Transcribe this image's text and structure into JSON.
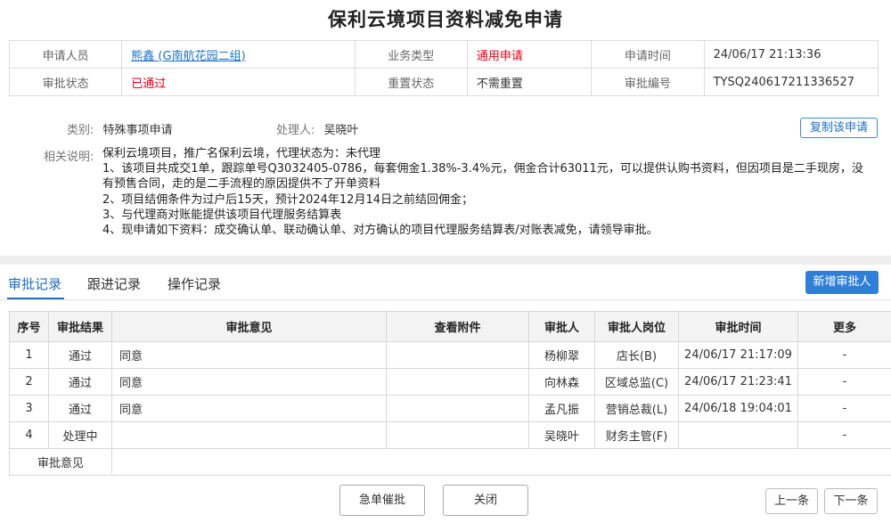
{
  "title": "保利云境项目资料减免申请",
  "info": {
    "applicant_label": "申请人员",
    "applicant_value": "熊鑫 (G南航花园二组)",
    "biz_type_label": "业务类型",
    "biz_type_value": "通用申请",
    "apply_time_label": "申请时间",
    "apply_time_value": "24/06/17 21:13:36",
    "approval_status_label": "审批状态",
    "approval_status_value": "已通过",
    "reset_status_label": "重置状态",
    "reset_status_value": "不需重置",
    "approval_no_label": "审批编号",
    "approval_no_value": "TYSQ240617211336527"
  },
  "category": {
    "label": "类别:",
    "value": "特殊事项申请"
  },
  "handler": {
    "label": "处理人:",
    "value": "吴晓叶"
  },
  "copy_button": "复制该申请",
  "description": {
    "label": "相关说明:",
    "lines": [
      "保利云境项目，推广名保利云境，代理状态为：未代理",
      "1、该项目共成交1单，跟踪单号Q3032405-0786，每套佣金1.38%-3.4%元，佣金合计63011元，可以提供认购书资料，但因项目是二手现房，没有预售合同，走的是二手流程的原因提供不了开单资料",
      "2、项目结佣条件为过户后15天，预计2024年12月14日之前结回佣金；",
      "3、与代理商对账能提供该项目代理服务结算表",
      "4、现申请如下资料：成交确认单、联动确认单、对方确认的项目代理服务结算表/对账表减免，请领导审批。"
    ]
  },
  "tabs": [
    "审批记录",
    "跟进记录",
    "操作记录"
  ],
  "add_approver_button": "新增审批人",
  "table": {
    "headers": [
      "序号",
      "审批结果",
      "审批意见",
      "查看附件",
      "审批人",
      "审批人岗位",
      "审批时间",
      "更多"
    ],
    "rows": [
      {
        "no": "1",
        "result": "通过",
        "opinion": "同意",
        "attachment": "",
        "approver": "杨柳翠",
        "position": "店长(B)",
        "time": "24/06/17 21:17:09",
        "more": "-"
      },
      {
        "no": "2",
        "result": "通过",
        "opinion": "同意",
        "attachment": "",
        "approver": "向林森",
        "position": "区域总监(C)",
        "time": "24/06/17 21:23:41",
        "more": "-"
      },
      {
        "no": "3",
        "result": "通过",
        "opinion": "同意",
        "attachment": "",
        "approver": "孟凡振",
        "position": "营销总裁(L)",
        "time": "24/06/18 19:04:01",
        "more": "-"
      },
      {
        "no": "4",
        "result": "处理中",
        "opinion": "",
        "attachment": "",
        "approver": "吴晓叶",
        "position": "财务主管(F)",
        "time": "",
        "more": "-"
      }
    ],
    "opinion_label": "审批意见"
  },
  "buttons": {
    "urge": "急单催批",
    "close": "关闭",
    "prev": "上一条",
    "next": "下一条"
  },
  "colors": {
    "accent": "#1f6fc2",
    "status_red": "#e60012",
    "primary_button": "#2f7ed8"
  }
}
